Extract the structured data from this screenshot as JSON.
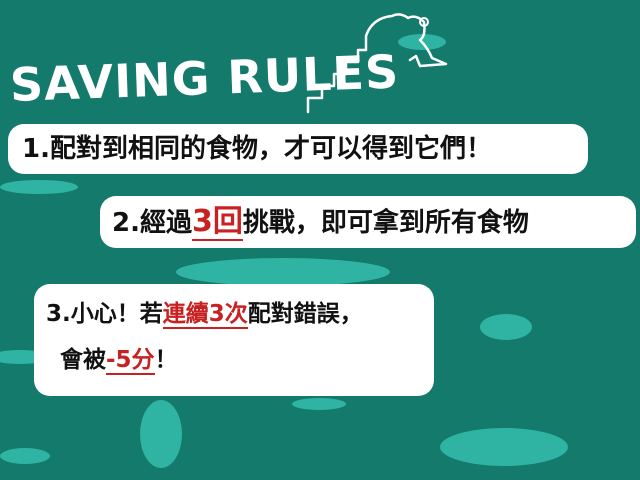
{
  "title": "SAVING RULES",
  "rule1": {
    "text": "1.配對到相同的食物，才可以得到它們！"
  },
  "rule2": {
    "pre": "2.經過",
    "num": "3",
    "unit": "回",
    "post": "挑戰，即可拿到所有食物"
  },
  "rule3": {
    "pre": "3.小心！若",
    "emph": "連續3次",
    "post": "配對錯誤，",
    "line2_pre": "會被",
    "penalty": "-5分",
    "line2_post": "！"
  },
  "colors": {
    "background": "#137a6c",
    "blob": "#2fb3a2",
    "card": "#ffffff",
    "highlight": "#c82121"
  }
}
